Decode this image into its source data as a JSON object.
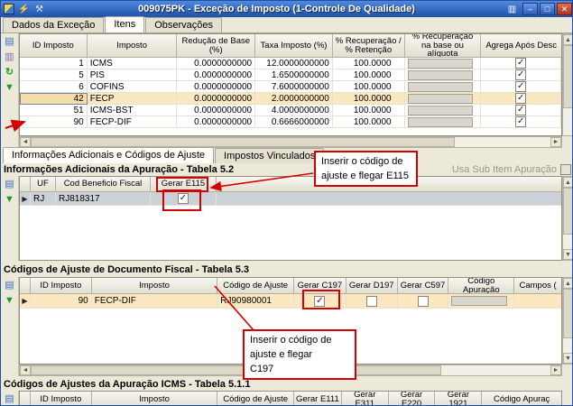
{
  "window": {
    "title": "009075PK - Exceção de Imposto (1-Controle De Qualidade)"
  },
  "icons": {
    "lightning": "⚡",
    "wrench": "⚒",
    "form": "▥",
    "minimize": "–",
    "maximize": "□",
    "close": "✕",
    "sheet": "▤",
    "sheet_alt": "▥",
    "refresh": "↻",
    "arrow_down": "▼",
    "arrow_up": "▲",
    "arrow_left": "◄",
    "arrow_right": "►",
    "row_marker": "▶"
  },
  "main_tabs": {
    "dados": "Dados da Exceção",
    "itens": "Itens",
    "observacoes": "Observações"
  },
  "sub_tabs": {
    "info": "Informações Adicionais e Códigos de Ajuste",
    "vinculados": "Impostos Vinculados"
  },
  "grid_impostos": {
    "columns": {
      "id": "ID Imposto",
      "imposto": "Imposto",
      "reducao": "Redução de Base (%)",
      "taxa": "Taxa Imposto (%)",
      "recuperacao": "% Recuperação / % Retenção",
      "recuperacao_base": "% Recuperação na base ou alíquota",
      "agrega": "Agrega Após Desc"
    },
    "rows": [
      {
        "id": "1",
        "imposto": "ICMS",
        "reducao": "0.0000000000",
        "taxa": "12.0000000000",
        "recuperacao": "100.0000",
        "agrega": "✓"
      },
      {
        "id": "5",
        "imposto": "PIS",
        "reducao": "0.0000000000",
        "taxa": "1.6500000000",
        "recuperacao": "100.0000",
        "agrega": "✓"
      },
      {
        "id": "6",
        "imposto": "COFINS",
        "reducao": "0.0000000000",
        "taxa": "7.6000000000",
        "recuperacao": "100.0000",
        "agrega": "✓"
      },
      {
        "id": "42",
        "imposto": "FECP",
        "reducao": "0.0000000000",
        "taxa": "2.0000000000",
        "recuperacao": "100.0000",
        "agrega": "✓"
      },
      {
        "id": "51",
        "imposto": "ICMS-BST",
        "reducao": "0.0000000000",
        "taxa": "4.0000000000",
        "recuperacao": "100.0000",
        "agrega": "✓"
      },
      {
        "id": "90",
        "imposto": "FECP-DIF",
        "reducao": "0.0000000000",
        "taxa": "0.6666000000",
        "recuperacao": "100.0000",
        "agrega": "✓"
      }
    ]
  },
  "tabela52": {
    "title": "Informações Adicionais da Apuração - Tabela 5.2",
    "usa_sub_item": "Usa Sub Item Apuração",
    "columns": {
      "uf": "UF",
      "cod": "Cod Beneficio Fiscal",
      "e115": "Gerar E115"
    },
    "row": {
      "marker": "▶",
      "uf": "RJ",
      "cod": "RJ818317",
      "e115": "✓"
    }
  },
  "tabela53": {
    "title": "Códigos de Ajuste de Documento Fiscal - Tabela 5.3",
    "columns": {
      "id": "ID Imposto",
      "imposto": "Imposto",
      "codigo": "Código de Ajuste",
      "c197": "Gerar C197",
      "d197": "Gerar D197",
      "c597": "Gerar C597",
      "apuracao": "Código Apuração",
      "campos": "Campos ("
    },
    "row": {
      "marker": "▶",
      "id": "90",
      "imposto": "FECP-DIF",
      "codigo": "RJ90980001",
      "c197": "✓",
      "d197": "",
      "c597": ""
    }
  },
  "tabela511": {
    "title": "Códigos de Ajustes da Apuração ICMS - Tabela 5.1.1",
    "columns": {
      "id": "ID Imposto",
      "imposto": "Imposto",
      "codigo": "Código de Ajuste",
      "e111": "Gerar E111",
      "e311": "Gerar E311",
      "e220": "Gerar E220",
      "g1921": "Gerar 1921",
      "apuracao": "Código Apuraç"
    }
  },
  "callout_e115": {
    "line1": "Inserir o código de",
    "line2": "ajuste e flegar E115"
  },
  "callout_c197": {
    "line1": "Inserir o código de",
    "line2": "ajuste e flegar",
    "line3": "C197"
  },
  "colors": {
    "accent_red": "#d40000",
    "highlight_row": "#fbe7c0",
    "selected_row": "#ccd1d8",
    "titlebar_blue": "#2d5cb4"
  }
}
